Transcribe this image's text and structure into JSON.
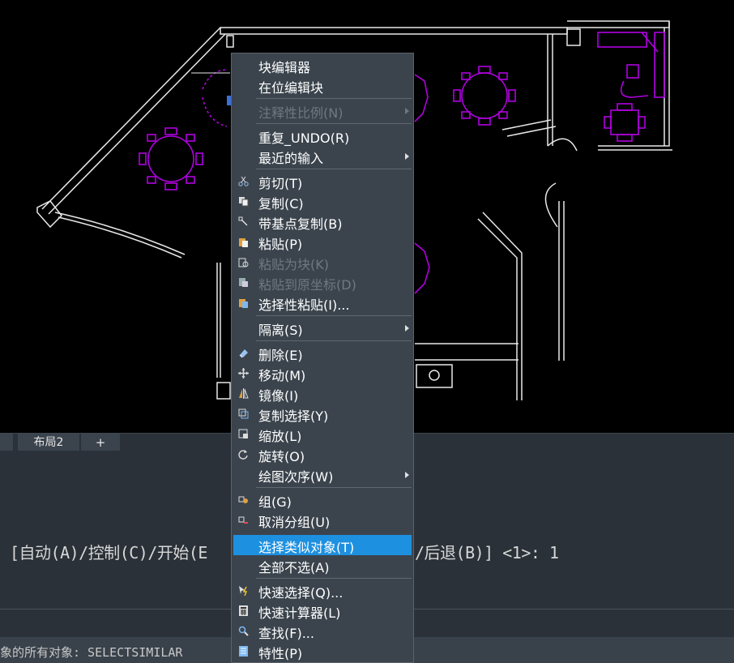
{
  "tabs": {
    "layout2": "布局2",
    "add": "+"
  },
  "command": {
    "line_left": "[自动(A)/控制(C)/开始(E",
    "line_right": "/后退(B)] <1>: 1",
    "status": "象的所有对象: SELECTSIMILAR"
  },
  "menu": {
    "block_editor": "块编辑器",
    "inplace_edit": "在位编辑块",
    "anno_scale": "注释性比例(N)",
    "repeat_undo": "重复_UNDO(R)",
    "recent_input": "最近的输入",
    "cut": "剪切(T)",
    "copy": "复制(C)",
    "copy_base": "带基点复制(B)",
    "paste": "粘贴(P)",
    "paste_block": "粘贴为块(K)",
    "paste_orig": "粘贴到原坐标(D)",
    "paste_special": "选择性粘贴(I)...",
    "isolate": "隔离(S)",
    "erase": "删除(E)",
    "move": "移动(M)",
    "mirror": "镜像(I)",
    "copy_sel": "复制选择(Y)",
    "scale": "缩放(L)",
    "rotate": "旋转(O)",
    "draw_order": "绘图次序(W)",
    "group": "组(G)",
    "ungroup": "取消分组(U)",
    "select_similar": "选择类似对象(T)",
    "deselect_all": "全部不选(A)",
    "quick_select": "快速选择(Q)...",
    "quick_calc": "快速计算器(L)",
    "find": "查找(F)...",
    "properties": "特性(P)"
  },
  "colors": {
    "highlight": "#1e90e0",
    "menu_bg": "#3b444d",
    "drawing_line": "#ffffff",
    "furniture": "#b000e0"
  }
}
